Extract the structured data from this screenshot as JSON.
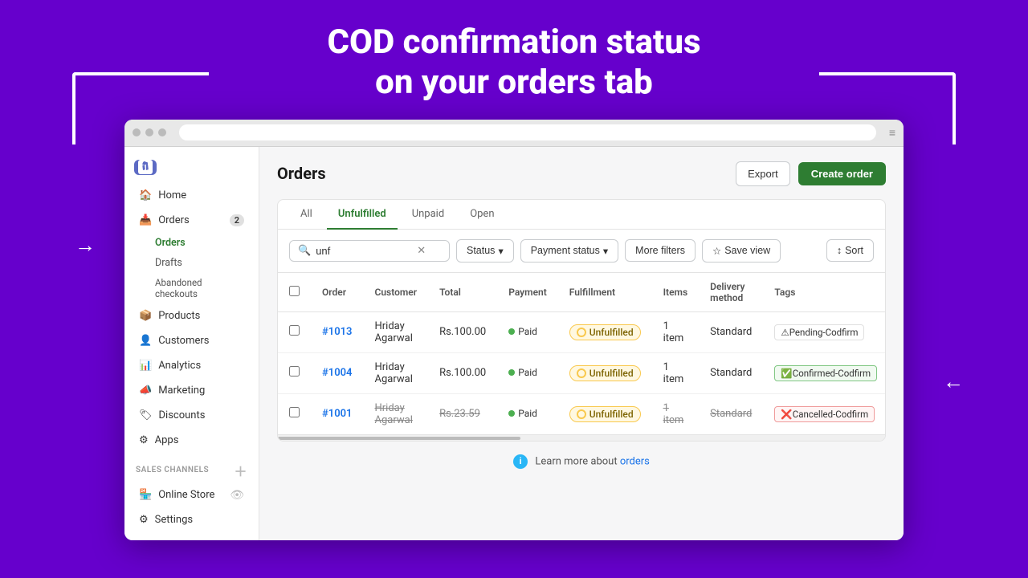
{
  "headline": {
    "line1": "COD confirmation status",
    "line2": "on your orders tab"
  },
  "browser": {
    "url": ""
  },
  "sidebar": {
    "logo_alt": "Shopify",
    "nav": [
      {
        "id": "home",
        "label": "Home",
        "icon": "home-icon"
      },
      {
        "id": "orders",
        "label": "Orders",
        "icon": "orders-icon",
        "badge": "2"
      },
      {
        "id": "orders-sub",
        "label": "Orders",
        "active": true
      },
      {
        "id": "drafts-sub",
        "label": "Drafts"
      },
      {
        "id": "abandoned-sub",
        "label": "Abandoned checkouts"
      },
      {
        "id": "products",
        "label": "Products",
        "icon": "products-icon"
      },
      {
        "id": "customers",
        "label": "Customers",
        "icon": "customers-icon"
      },
      {
        "id": "analytics",
        "label": "Analytics",
        "icon": "analytics-icon"
      },
      {
        "id": "marketing",
        "label": "Marketing",
        "icon": "marketing-icon"
      },
      {
        "id": "discounts",
        "label": "Discounts",
        "icon": "discounts-icon"
      },
      {
        "id": "apps",
        "label": "Apps",
        "icon": "apps-icon"
      }
    ],
    "sales_channels_header": "SALES CHANNELS",
    "online_store": "Online Store",
    "settings": "Settings"
  },
  "orders": {
    "page_title": "Orders",
    "export_label": "Export",
    "create_order_label": "Create order",
    "tabs": [
      {
        "id": "all",
        "label": "All"
      },
      {
        "id": "unfulfilled",
        "label": "Unfulfilled",
        "active": true
      },
      {
        "id": "unpaid",
        "label": "Unpaid"
      },
      {
        "id": "open",
        "label": "Open"
      }
    ],
    "filters": {
      "search_value": "unf",
      "search_placeholder": "unf",
      "status_label": "Status",
      "payment_status_label": "Payment status",
      "more_filters_label": "More filters",
      "save_view_label": "Save view",
      "sort_label": "Sort"
    },
    "table": {
      "columns": [
        "Order",
        "Customer",
        "Total",
        "Payment",
        "Fulfillment",
        "Items",
        "Delivery method",
        "Tags"
      ],
      "rows": [
        {
          "id": "#1013",
          "customer": "Hriday Agarwal",
          "total": "Rs.100.00",
          "payment": "Paid",
          "fulfillment": "Unfulfilled",
          "items": "1 item",
          "delivery": "Standard",
          "tag": "⚠Pending-Codfirm",
          "tag_type": "pending",
          "strikethrough": false
        },
        {
          "id": "#1004",
          "customer": "Hriday Agarwal",
          "total": "Rs.100.00",
          "payment": "Paid",
          "fulfillment": "Unfulfilled",
          "items": "1 item",
          "delivery": "Standard",
          "tag": "✅Confirmed-Codfirm",
          "tag_type": "confirmed",
          "strikethrough": false
        },
        {
          "id": "#1001",
          "customer": "Hriday Agarwal",
          "total": "Rs.23.59",
          "payment": "Paid",
          "fulfillment": "Unfulfilled",
          "items": "1 item",
          "delivery": "Standard",
          "tag": "❌Cancelled-Codfirm",
          "tag_type": "cancelled",
          "strikethrough": true
        }
      ]
    },
    "learn_more_text": "Learn more about",
    "learn_more_link": "orders"
  }
}
